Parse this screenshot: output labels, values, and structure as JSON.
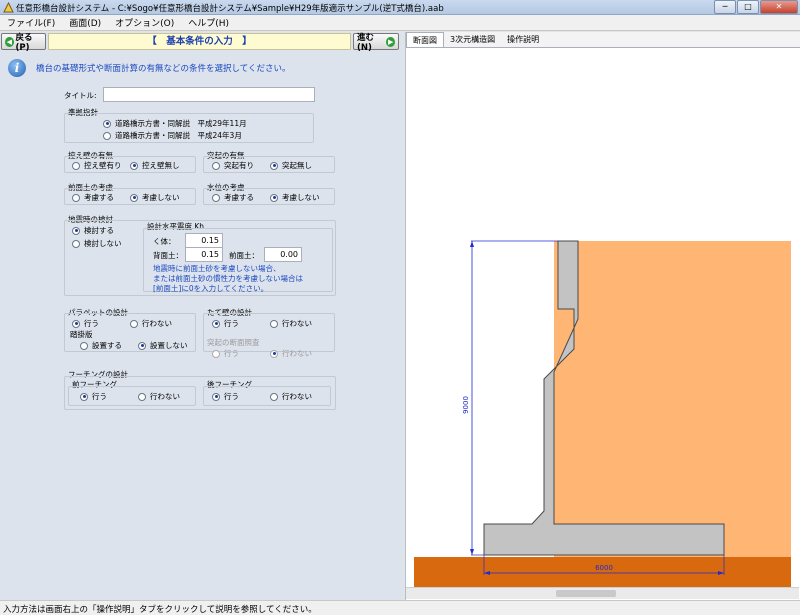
{
  "window": {
    "title": "任意形橋台設計システム - C:¥Sogo¥任意形橋台設計システム¥Sample¥H29年版適示サンプル(逆T式橋台).aab",
    "min_label": "─",
    "max_label": "□",
    "close_label": "✕"
  },
  "menu": [
    "ファイル(F)",
    "画面(D)",
    "オプション(O)",
    "ヘルプ(H)"
  ],
  "toolbar": {
    "back_label": "戻る(P)",
    "next_label": "進む(N)",
    "page_title": "【　基本条件の入力　】"
  },
  "info_text": "橋台の基礎形式や断面計算の有無などの条件を選択してください。",
  "title_field": {
    "label": "タイトル:",
    "value": ""
  },
  "standard": {
    "label": "準拠指針",
    "options": [
      "道路橋示方書・同解説　平成29年11月",
      "道路橋示方書・同解説　平成24年3月"
    ],
    "selected": 0
  },
  "retaining_wall": {
    "label": "控え壁の有無",
    "options": [
      "控え壁有り",
      "控え壁無し"
    ],
    "selected": 1
  },
  "projection": {
    "label": "突起の有無",
    "options": [
      "突起有り",
      "突起無し"
    ],
    "selected": 1
  },
  "front_soil": {
    "label": "前面土の考慮",
    "options": [
      "考慮する",
      "考慮しない"
    ],
    "selected": 1
  },
  "water_level": {
    "label": "水位の考慮",
    "options": [
      "考慮する",
      "考慮しない"
    ],
    "selected": 1
  },
  "seismic": {
    "label": "地震時の検討",
    "options": [
      "検討する",
      "検討しない"
    ],
    "selected": 0,
    "kh_label": "設計水平震度 Kh",
    "body_label": "く体：",
    "body_value": "0.15",
    "back_soil_label": "背面土：",
    "back_soil_value": "0.15",
    "front_soil_label": "前面土：",
    "front_soil_value": "0.00",
    "note_lines": [
      "地震時に前面土砂を考慮しない場合、",
      "または前面土砂の慣性力を考慮しない場合は",
      "[前面土]に0を入力してください。"
    ]
  },
  "parapet": {
    "label": "パラペットの設計",
    "options": [
      "行う",
      "行わない"
    ],
    "selected": 0,
    "sub_label": "踏掛版",
    "sub_options": [
      "設置する",
      "設置しない"
    ],
    "sub_selected": 1
  },
  "vertical_wall": {
    "label": "たて壁の設計",
    "options": [
      "行う",
      "行わない"
    ],
    "selected": 0,
    "sub_label": "突起の断面照査",
    "sub_options": [
      "行う",
      "行わない"
    ],
    "sub_selected": 1
  },
  "footing": {
    "label": "フーチングの設計",
    "front_label": "前フーチング",
    "front_options": [
      "行う",
      "行わない"
    ],
    "front_selected": 0,
    "rear_label": "後フーチング",
    "rear_options": [
      "行う",
      "行わない"
    ],
    "rear_selected": 0
  },
  "right_tabs": [
    "断面図",
    "3次元構造図",
    "操作説明"
  ],
  "active_tab": 0,
  "drawing": {
    "height_dim": "9000",
    "width_dim": "6000",
    "colors": {
      "backfill": "#ffb573",
      "ground": "#d9690f",
      "concrete": "#c3c3c3",
      "dim": "#1f2bd0"
    }
  },
  "statusbar": "入力方法は画面右上の「操作説明」タブをクリックして説明を参照してください。"
}
